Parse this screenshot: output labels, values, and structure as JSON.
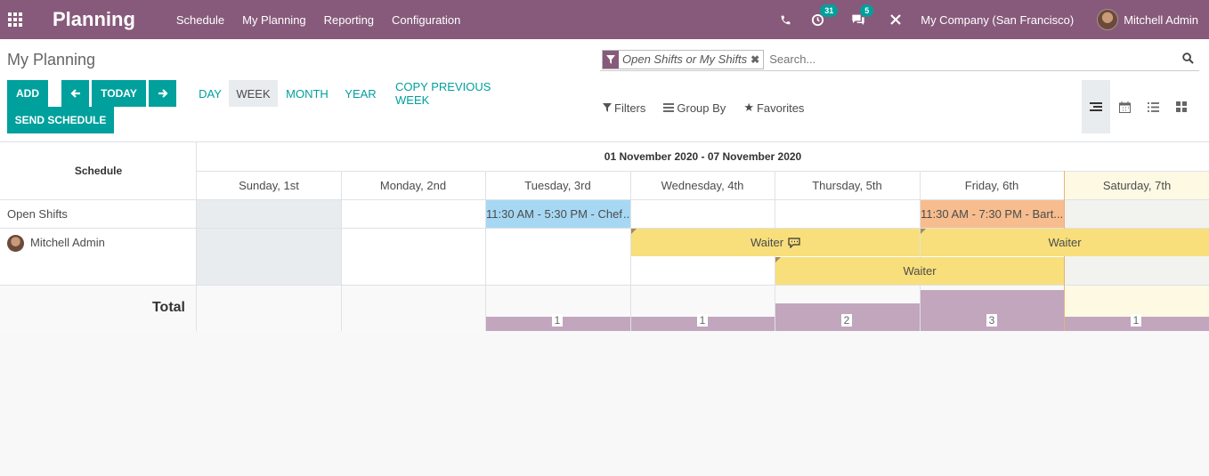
{
  "navbar": {
    "brand": "Planning",
    "menu": [
      "Schedule",
      "My Planning",
      "Reporting",
      "Configuration"
    ],
    "activity_count": "31",
    "message_count": "5",
    "company": "My Company (San Francisco)",
    "user": "Mitchell Admin",
    "icons": [
      "apps-icon",
      "phone-icon",
      "clock-icon",
      "chat-icon",
      "close-icon"
    ]
  },
  "control_panel": {
    "breadcrumb": "My Planning",
    "buttons": {
      "add": "ADD",
      "today": "TODAY",
      "send_schedule": "SEND SCHEDULE",
      "copy_previous_week": "COPY PREVIOUS WEEK"
    },
    "scales": [
      "DAY",
      "WEEK",
      "MONTH",
      "YEAR"
    ],
    "active_scale": "WEEK",
    "search": {
      "facet": "Open Shifts or My Shifts",
      "placeholder": "Search..."
    },
    "filters": {
      "filters": "Filters",
      "group_by": "Group By",
      "favorites": "Favorites"
    },
    "views": [
      "gantt-view-icon",
      "calendar-view-icon",
      "list-view-icon",
      "kanban-view-icon"
    ],
    "active_view": "gantt-view-icon"
  },
  "gantt": {
    "schedule_header": "Schedule",
    "range": "01 November 2020 - 07 November 2020",
    "days": [
      "Sunday, 1st",
      "Monday, 2nd",
      "Tuesday, 3rd",
      "Wednesday, 4th",
      "Thursday, 5th",
      "Friday, 6th",
      "Saturday, 7th"
    ],
    "rows": [
      {
        "label": "Open Shifts"
      },
      {
        "label": "Mitchell Admin"
      }
    ],
    "pills": {
      "chef": "11:30 AM - 5:30 PM - Chef",
      "bartender": "11:30 AM - 7:30 PM - Bart",
      "waiter_1": "Waiter",
      "waiter_2": "Waiter",
      "waiter_3": "Waiter"
    },
    "total_label": "Total",
    "totals": [
      "",
      "",
      "1",
      "1",
      "2",
      "3",
      "1"
    ],
    "colors": {
      "chef": "#a6d8f4",
      "bartender": "#f7bd8e",
      "waiter": "#f8df7b",
      "total_bar": "#c1a6bd",
      "today_column": "#fdf9e3",
      "closed_day": "#e9ecef"
    }
  }
}
